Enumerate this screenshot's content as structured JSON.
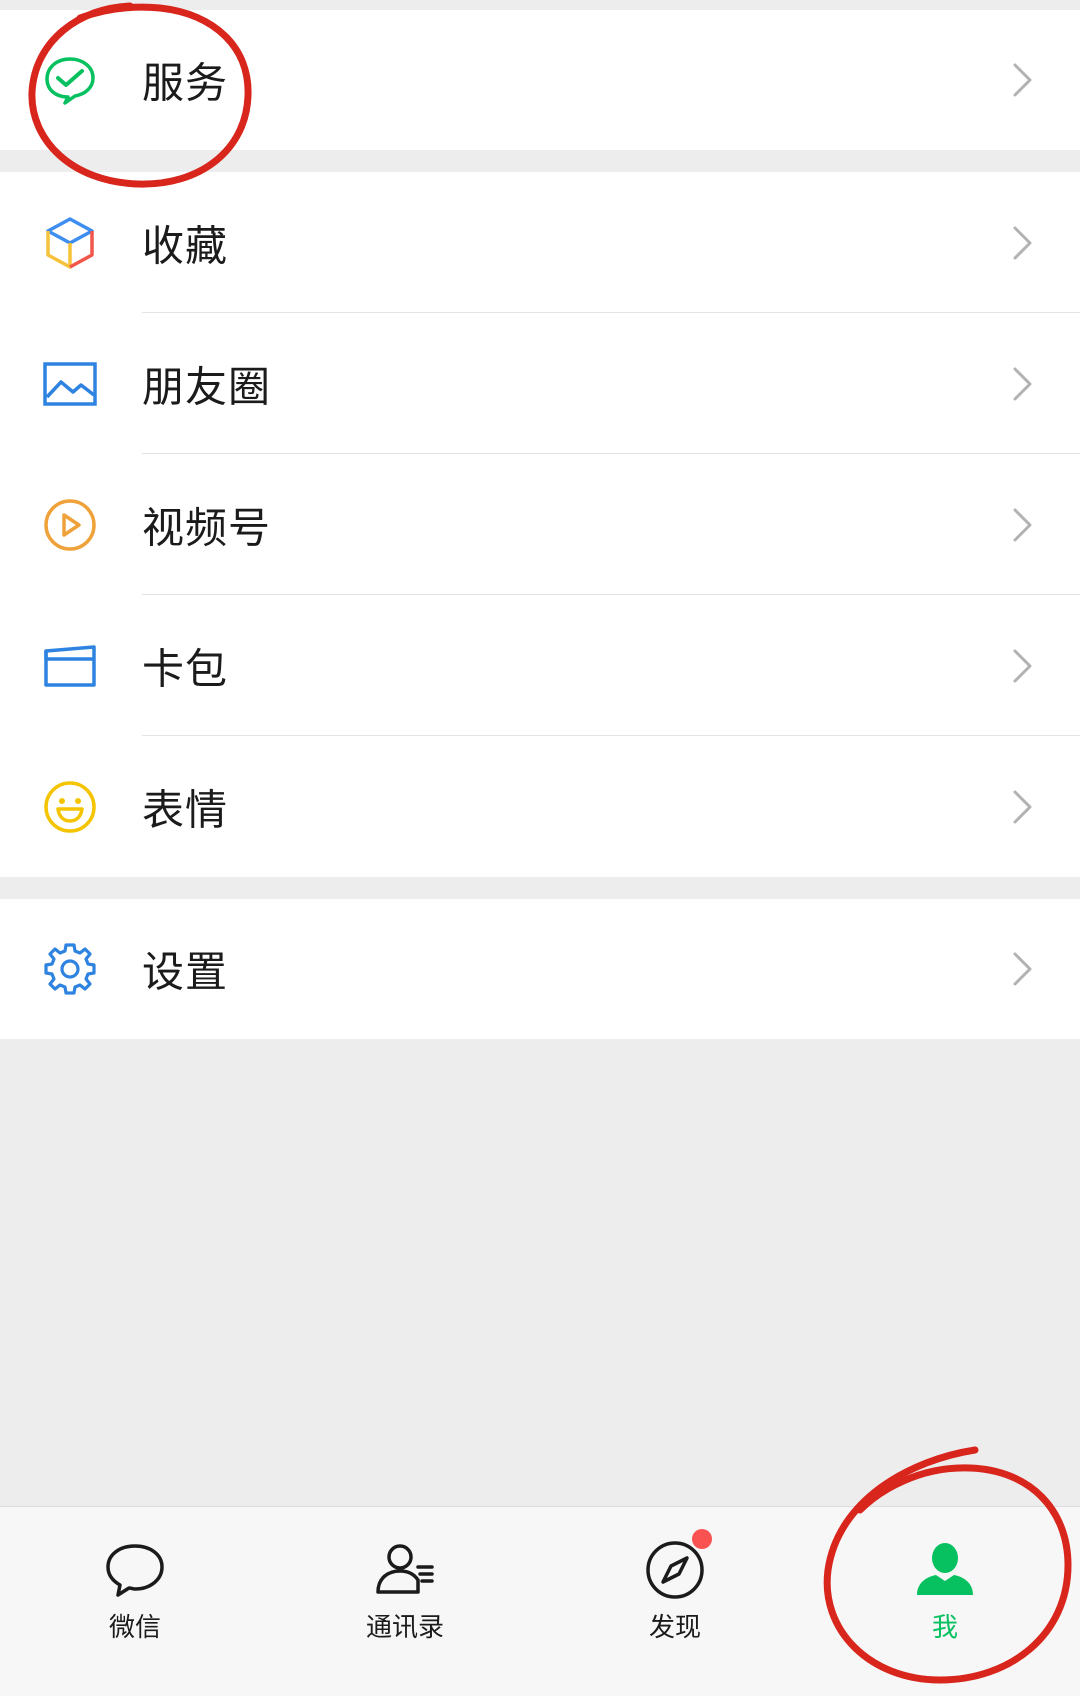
{
  "menu": {
    "services": {
      "label": "服务",
      "icon": "wechat-pay-check-icon"
    },
    "favorites": {
      "label": "收藏",
      "icon": "cube-icon"
    },
    "moments": {
      "label": "朋友圈",
      "icon": "picture-icon"
    },
    "channels": {
      "label": "视频号",
      "icon": "play-circle-icon"
    },
    "cards": {
      "label": "卡包",
      "icon": "card-wallet-icon"
    },
    "stickers": {
      "label": "表情",
      "icon": "smiley-icon"
    },
    "settings": {
      "label": "设置",
      "icon": "gear-icon"
    }
  },
  "tabbar": {
    "chats": {
      "label": "微信",
      "icon": "chat-bubble-icon"
    },
    "contacts": {
      "label": "通讯录",
      "icon": "contacts-icon"
    },
    "discover": {
      "label": "发现",
      "icon": "compass-icon",
      "has_badge": true
    },
    "me": {
      "label": "我",
      "icon": "person-icon",
      "active": true
    }
  },
  "colors": {
    "accent": "#07c160",
    "badge": "#fa5151",
    "annotation": "#d8261c",
    "page_bg": "#ededed"
  }
}
